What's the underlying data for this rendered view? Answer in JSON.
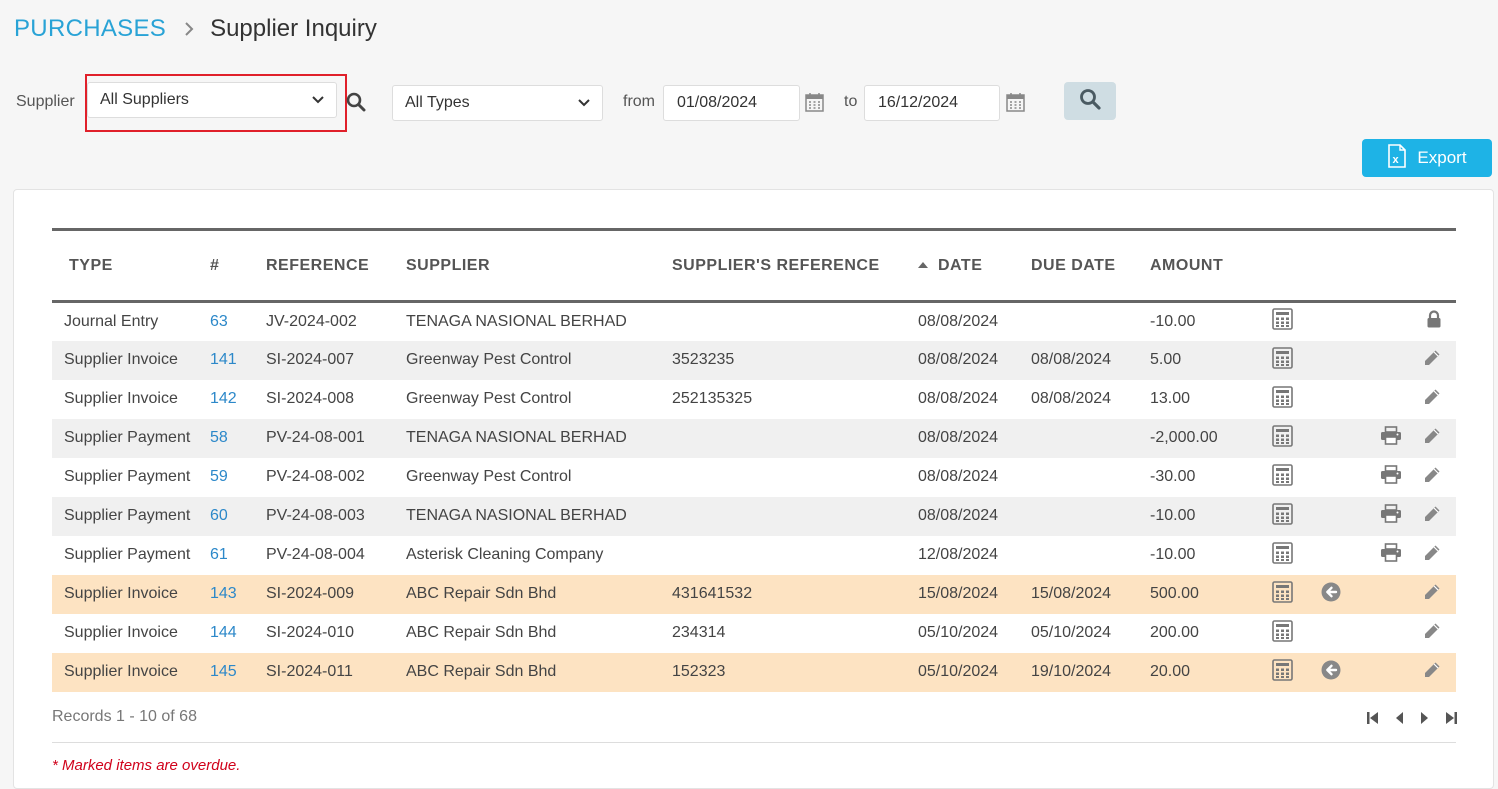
{
  "breadcrumb": {
    "section": "PURCHASES",
    "page": "Supplier Inquiry"
  },
  "filters": {
    "supplier_label": "Supplier",
    "supplier_value": "All Suppliers",
    "type_value": "All Types",
    "from_label": "from",
    "from_date": "01/08/2024",
    "to_label": "to",
    "to_date": "16/12/2024"
  },
  "export_label": "Export",
  "columns": {
    "type": "TYPE",
    "num": "#",
    "reference": "REFERENCE",
    "supplier": "SUPPLIER",
    "supplier_ref": "SUPPLIER'S REFERENCE",
    "date": "DATE",
    "due_date": "DUE DATE",
    "amount": "AMOUNT"
  },
  "rows": [
    {
      "type": "Journal Entry",
      "num": "63",
      "reference": "JV-2024-002",
      "supplier": "TENAGA NASIONAL BERHAD",
      "supplier_ref": "",
      "date": "08/08/2024",
      "due_date": "",
      "amount": "-10.00",
      "style": "odd",
      "calc": true,
      "back": false,
      "print": false,
      "action": "lock"
    },
    {
      "type": "Supplier Invoice",
      "num": "141",
      "reference": "SI-2024-007",
      "supplier": "Greenway Pest Control",
      "supplier_ref": "3523235",
      "date": "08/08/2024",
      "due_date": "08/08/2024",
      "amount": "5.00",
      "style": "even",
      "calc": true,
      "back": false,
      "print": false,
      "action": "edit"
    },
    {
      "type": "Supplier Invoice",
      "num": "142",
      "reference": "SI-2024-008",
      "supplier": "Greenway Pest Control",
      "supplier_ref": "252135325",
      "date": "08/08/2024",
      "due_date": "08/08/2024",
      "amount": "13.00",
      "style": "odd",
      "calc": true,
      "back": false,
      "print": false,
      "action": "edit"
    },
    {
      "type": "Supplier Payment",
      "num": "58",
      "reference": "PV-24-08-001",
      "supplier": "TENAGA NASIONAL BERHAD",
      "supplier_ref": "",
      "date": "08/08/2024",
      "due_date": "",
      "amount": "-2,000.00",
      "style": "even",
      "calc": true,
      "back": false,
      "print": true,
      "action": "edit"
    },
    {
      "type": "Supplier Payment",
      "num": "59",
      "reference": "PV-24-08-002",
      "supplier": "Greenway Pest Control",
      "supplier_ref": "",
      "date": "08/08/2024",
      "due_date": "",
      "amount": "-30.00",
      "style": "odd",
      "calc": true,
      "back": false,
      "print": true,
      "action": "edit"
    },
    {
      "type": "Supplier Payment",
      "num": "60",
      "reference": "PV-24-08-003",
      "supplier": "TENAGA NASIONAL BERHAD",
      "supplier_ref": "",
      "date": "08/08/2024",
      "due_date": "",
      "amount": "-10.00",
      "style": "even",
      "calc": true,
      "back": false,
      "print": true,
      "action": "edit"
    },
    {
      "type": "Supplier Payment",
      "num": "61",
      "reference": "PV-24-08-004",
      "supplier": "Asterisk Cleaning Company",
      "supplier_ref": "",
      "date": "12/08/2024",
      "due_date": "",
      "amount": "-10.00",
      "style": "odd",
      "calc": true,
      "back": false,
      "print": true,
      "action": "edit"
    },
    {
      "type": "Supplier Invoice",
      "num": "143",
      "reference": "SI-2024-009",
      "supplier": "ABC Repair Sdn Bhd",
      "supplier_ref": "431641532",
      "date": "15/08/2024",
      "due_date": "15/08/2024",
      "amount": "500.00",
      "style": "overdue",
      "calc": true,
      "back": true,
      "print": false,
      "action": "edit"
    },
    {
      "type": "Supplier Invoice",
      "num": "144",
      "reference": "SI-2024-010",
      "supplier": "ABC Repair Sdn Bhd",
      "supplier_ref": "234314",
      "date": "05/10/2024",
      "due_date": "05/10/2024",
      "amount": "200.00",
      "style": "odd",
      "calc": true,
      "back": false,
      "print": false,
      "action": "edit"
    },
    {
      "type": "Supplier Invoice",
      "num": "145",
      "reference": "SI-2024-011",
      "supplier": "ABC Repair Sdn Bhd",
      "supplier_ref": "152323",
      "date": "05/10/2024",
      "due_date": "19/10/2024",
      "amount": "20.00",
      "style": "overdue",
      "calc": true,
      "back": true,
      "print": false,
      "action": "edit"
    }
  ],
  "records_text": "Records 1 - 10 of 68",
  "overdue_note": "* Marked items are overdue.",
  "colors": {
    "link": "#29a3d6",
    "overdue_row": "#fde3c2",
    "export_button": "#1eb3e6",
    "highlight": "#e0202a"
  }
}
